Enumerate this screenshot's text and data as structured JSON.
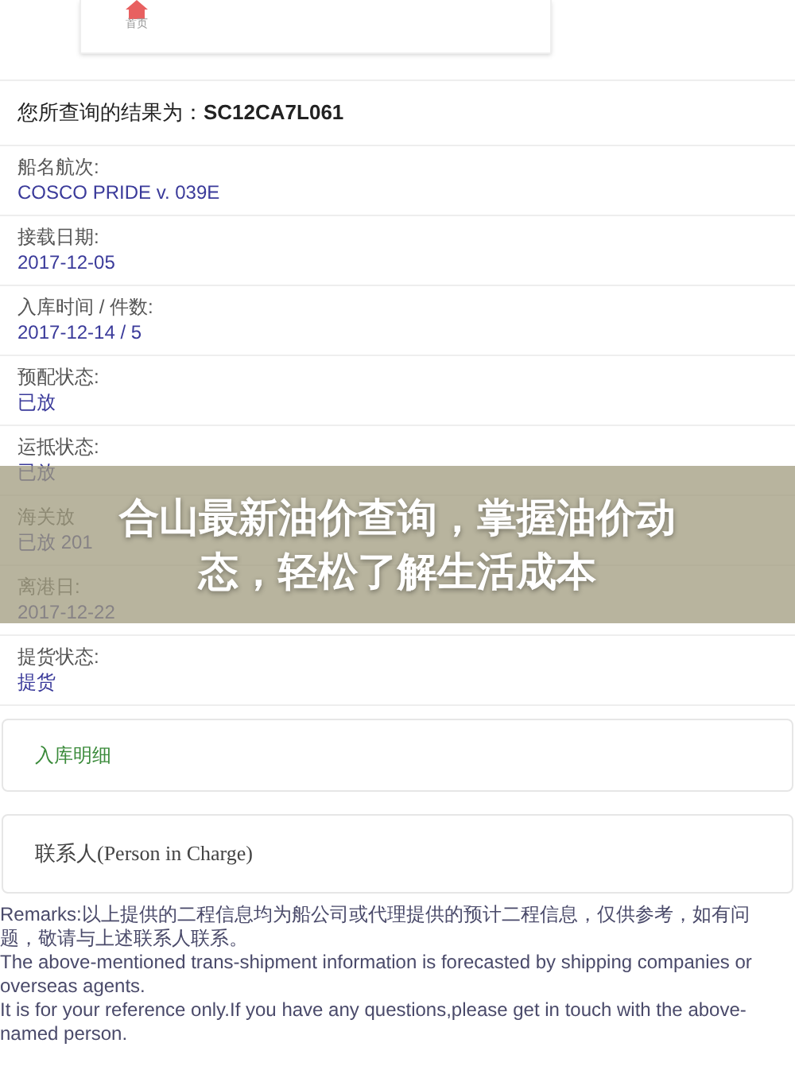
{
  "nav": {
    "home_label": "首页"
  },
  "result": {
    "label": "您所查询的结果为：",
    "value": "SC12CA7L061"
  },
  "fields": [
    {
      "label": "船名航次:",
      "value": "COSCO PRIDE v. 039E"
    },
    {
      "label": "接载日期:",
      "value": "2017-12-05"
    },
    {
      "label": "入库时间 / 件数:",
      "value": "2017-12-14 / 5"
    },
    {
      "label": "预配状态:",
      "value": "已放"
    },
    {
      "label": "运抵状态:",
      "value": "已放"
    },
    {
      "label": "海关放",
      "value": "已放 201"
    },
    {
      "label": "离港日:",
      "value": "2017-12-22"
    },
    {
      "label": "提货状态:",
      "value": "提货"
    }
  ],
  "detail_link": "入库明细",
  "contact_title": "联系人(Person in Charge)",
  "remarks": [
    "Remarks:以上提供的二程信息均为船公司或代理提供的预计二程信息，仅供参考，如有问题，敬请与上述联系人联系。",
    "The above-mentioned trans-shipment information is forecasted by shipping companies or overseas agents.",
    "It is for your reference only.If you have any questions,please get in touch with the above-named person."
  ],
  "banner": {
    "title": "合山最新油价查询，掌握油价动态，轻松了解生活成本"
  }
}
